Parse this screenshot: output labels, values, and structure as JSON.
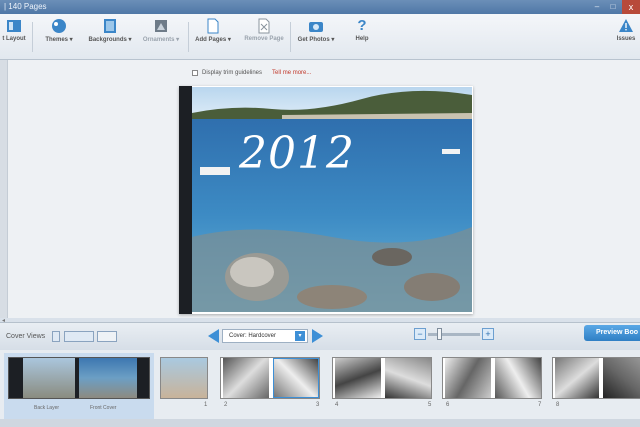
{
  "window": {
    "title": "| 140 Pages",
    "close": "x"
  },
  "toolbar": {
    "items": [
      {
        "label": "t Layout",
        "icon": "layout-icon"
      },
      {
        "label": "Themes ▾",
        "icon": "themes-icon"
      },
      {
        "label": "Backgrounds ▾",
        "icon": "backgrounds-icon"
      },
      {
        "label": "Ornaments ▾",
        "icon": "ornaments-icon"
      },
      {
        "label": "Add Pages ▾",
        "icon": "add-page-icon"
      },
      {
        "label": "Remove Page",
        "icon": "remove-page-icon"
      },
      {
        "label": "Get Photos ▾",
        "icon": "camera-icon"
      },
      {
        "label": "Help",
        "icon": "help-icon"
      },
      {
        "label": "Issues",
        "icon": "warning-icon"
      }
    ]
  },
  "workspace": {
    "trim_label": "Display trim guidelines",
    "tell_me": "Tell me more...",
    "cover_text": "2012"
  },
  "controls": {
    "cover_views_label": "Cover Views",
    "cover_select": "Cover: Hardcover",
    "preview_label": "Preview Boo",
    "zoom_level": 0.2
  },
  "filmstrip": {
    "back_label": "Back Layer",
    "front_label": "Front Cover",
    "page_numbers": [
      "1",
      "2",
      "3",
      "4",
      "5",
      "6",
      "7",
      "8"
    ]
  },
  "colors": {
    "accent": "#3d8fd6",
    "link": "#c0392b"
  }
}
